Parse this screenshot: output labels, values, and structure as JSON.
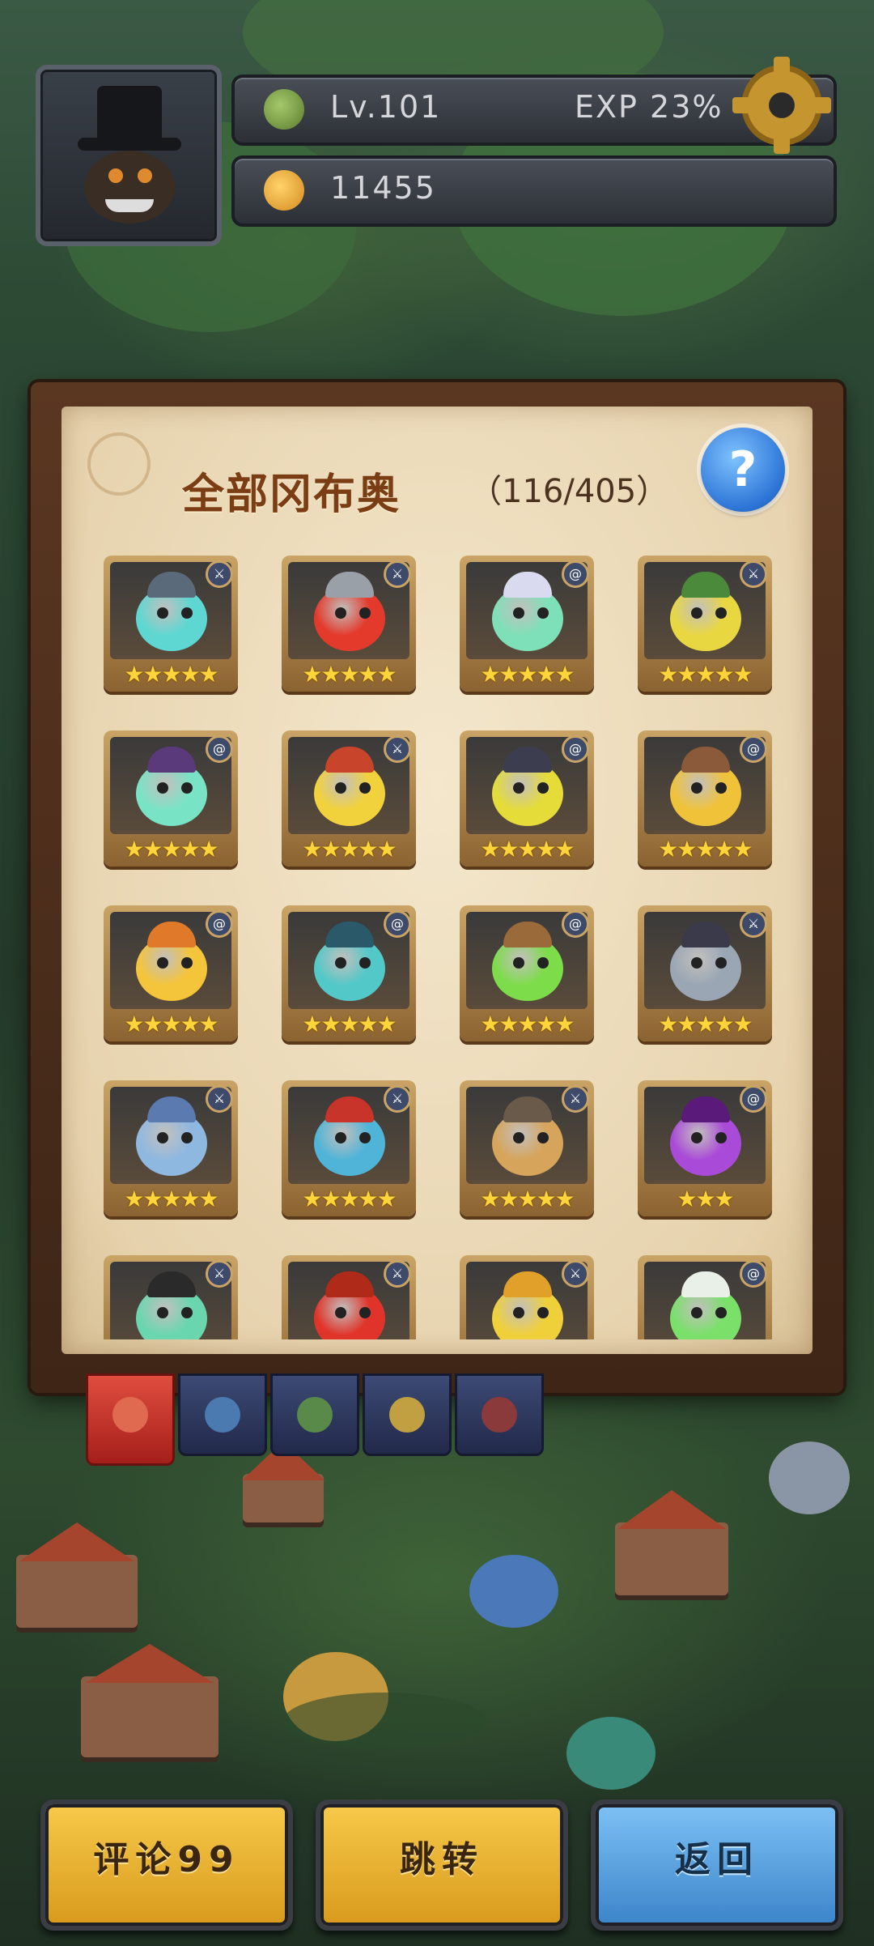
{
  "player": {
    "level_label": "Lv.101",
    "exp_label": "EXP 23%",
    "currency_amount": "11455"
  },
  "collection": {
    "title": "全部冈布奥",
    "count": "（116/405）",
    "help_icon": "?"
  },
  "monsters": [
    {
      "stars": 5,
      "color": "#5ed7d2",
      "hat": "#5a6a7a",
      "badge": "sword-icon"
    },
    {
      "stars": 5,
      "color": "#e33a2c",
      "hat": "#9aa0a8",
      "badge": "sword-icon"
    },
    {
      "stars": 5,
      "color": "#7ee0b8",
      "hat": "#d9d9f0",
      "badge": "swirl-icon"
    },
    {
      "stars": 5,
      "color": "#e9d742",
      "hat": "#4b8a3a",
      "badge": "sword-icon"
    },
    {
      "stars": 5,
      "color": "#79e3c6",
      "hat": "#5a3a7a",
      "badge": "swirl-icon"
    },
    {
      "stars": 5,
      "color": "#f2d23c",
      "hat": "#c8442a",
      "badge": "sword-icon"
    },
    {
      "stars": 5,
      "color": "#e5dc3a",
      "hat": "#3d3d50",
      "badge": "swirl-icon"
    },
    {
      "stars": 5,
      "color": "#f0c23a",
      "hat": "#8a5a3a",
      "badge": "swirl-icon"
    },
    {
      "stars": 5,
      "color": "#f4c43a",
      "hat": "#e07a2a",
      "badge": "swirl-icon"
    },
    {
      "stars": 5,
      "color": "#53c8c8",
      "hat": "#2a5a6a",
      "badge": "swirl-icon"
    },
    {
      "stars": 5,
      "color": "#7ddc4a",
      "hat": "#9a6a3a",
      "badge": "swirl-icon"
    },
    {
      "stars": 5,
      "color": "#9aa6b4",
      "hat": "#3a3a4a",
      "badge": "sword-icon"
    },
    {
      "stars": 5,
      "color": "#8fb8e0",
      "hat": "#5a7ab0",
      "badge": "sword-icon"
    },
    {
      "stars": 5,
      "color": "#4fb4d8",
      "hat": "#c8342a",
      "badge": "sword-icon"
    },
    {
      "stars": 5,
      "color": "#d6a45a",
      "hat": "#6a5a4a",
      "badge": "sword-icon"
    },
    {
      "stars": 3,
      "color": "#a94ad8",
      "hat": "#5a1a7a",
      "badge": "swirl-icon"
    },
    {
      "stars": 0,
      "color": "#6ad6b0",
      "hat": "#2a2a2a",
      "badge": "sword-icon"
    },
    {
      "stars": 0,
      "color": "#e0342a",
      "hat": "#b02a1a",
      "badge": "sword-icon"
    },
    {
      "stars": 0,
      "color": "#f0d03a",
      "hat": "#e0a02a",
      "badge": "sword-icon"
    },
    {
      "stars": 0,
      "color": "#7ae06a",
      "hat": "#e8f0e8",
      "badge": "swirl-icon"
    }
  ],
  "categories": [
    {
      "name": "all-category",
      "color": "#e06a50"
    },
    {
      "name": "category-2",
      "color": "#4a7ab0"
    },
    {
      "name": "category-3",
      "color": "#5a8a4a"
    },
    {
      "name": "category-4",
      "color": "#c0a040"
    },
    {
      "name": "category-5",
      "color": "#8a3a3a"
    }
  ],
  "buttons": {
    "comment": "评论99",
    "jump": "跳转",
    "back": "返回"
  },
  "colors": {
    "star": "#ffd53b",
    "gold_button": "#f0c040",
    "blue_button": "#5aa0e0"
  }
}
